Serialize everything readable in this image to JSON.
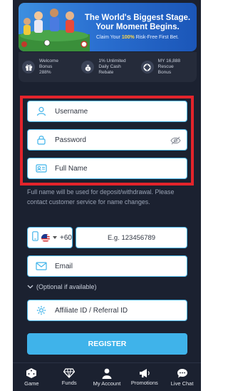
{
  "banner": {
    "title_line1": "The World's Biggest Stage.",
    "title_line2": "Your Moment Begins.",
    "subtitle_prefix": "Claim Your ",
    "subtitle_highlight": "100%",
    "subtitle_suffix": " Risk-Free First Bet."
  },
  "promos": [
    {
      "icon": "gift-icon",
      "line1": "Welcome",
      "line2": "Bonus",
      "line3": "288%"
    },
    {
      "icon": "cash-bag-icon",
      "line1": "1% Unlimited",
      "line2": "Daily Cash",
      "line3": "Rebate"
    },
    {
      "icon": "lifebuoy-icon",
      "line1": "MY 16,888",
      "line2": "Rescue",
      "line3": "Bonus"
    }
  ],
  "form": {
    "username_placeholder": "Username",
    "password_placeholder": "Password",
    "fullname_placeholder": "Full Name",
    "fullname_note": "Full name will be used for deposit/withdrawal. Please contact customer service for name changes.",
    "phone_prefix": "+60",
    "phone_placeholder": "E.g. 123456789",
    "email_placeholder": "Email",
    "optional_label": "(Optional if available)",
    "affiliate_placeholder": "Affiliate ID / Referral ID",
    "register_label": "REGISTER"
  },
  "nav": {
    "items": [
      {
        "label": "Game",
        "icon": "dice-icon"
      },
      {
        "label": "Funds",
        "icon": "diamond-icon"
      },
      {
        "label": "My Account",
        "icon": "user-icon"
      },
      {
        "label": "Promotions",
        "icon": "megaphone-icon"
      },
      {
        "label": "Live Chat",
        "icon": "chat-icon"
      }
    ]
  },
  "colors": {
    "background": "#1b2130",
    "accent": "#3fb3ea",
    "highlight": "#e3242b"
  }
}
